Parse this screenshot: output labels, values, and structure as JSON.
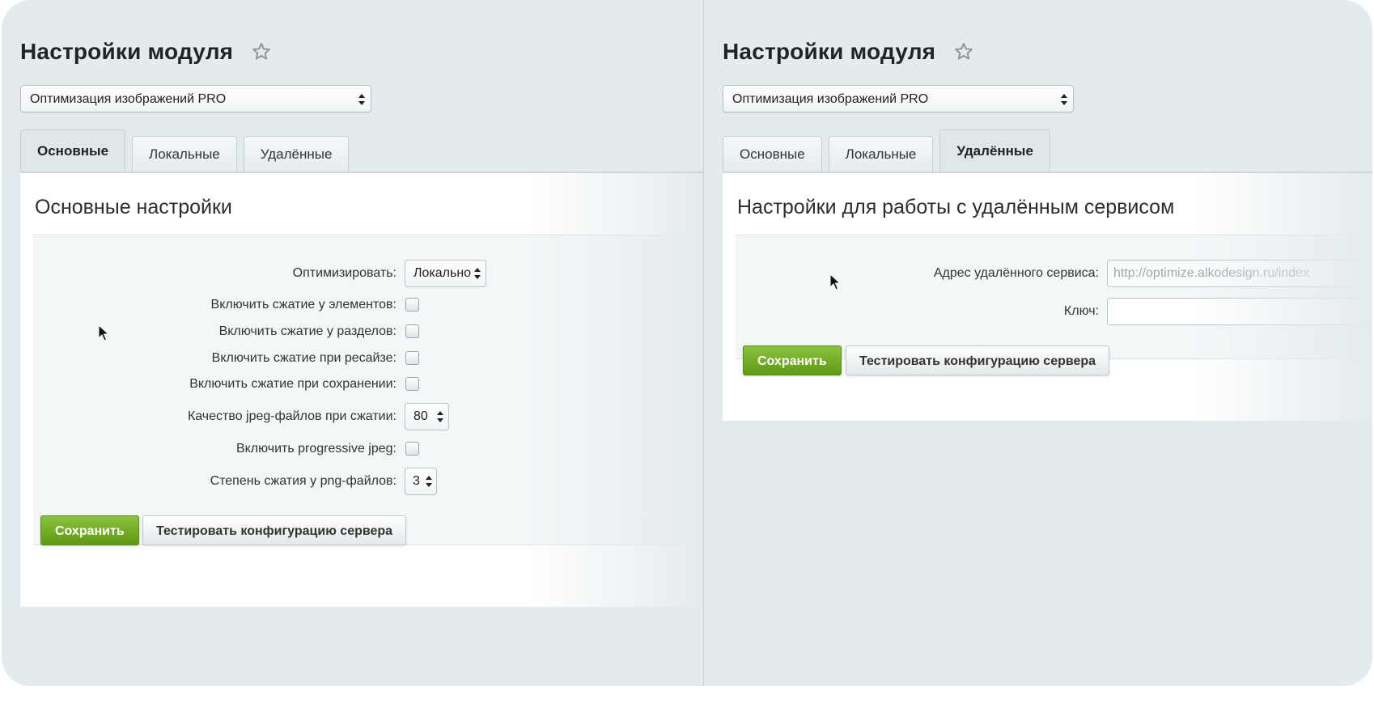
{
  "left": {
    "page_title": "Настройки модуля",
    "module_select_value": "Оптимизация изображений PRO",
    "tabs": [
      {
        "label": "Основные",
        "active": true
      },
      {
        "label": "Локальные",
        "active": false
      },
      {
        "label": "Удалённые",
        "active": false
      }
    ],
    "section_title": "Основные настройки",
    "fields": {
      "optimize_label": "Оптимизировать:",
      "optimize_value": "Локально",
      "elements_label": "Включить сжатие у элементов:",
      "sections_label": "Включить сжатие у разделов:",
      "resize_label": "Включить сжатие при ресайзе:",
      "save_compress_label": "Включить сжатие при сохранении:",
      "jpeg_quality_label": "Качество jpeg-файлов при сжатии:",
      "jpeg_quality_value": "80",
      "progressive_label": "Включить progressive jpeg:",
      "png_level_label": "Степень сжатия у png-файлов:",
      "png_level_value": "3"
    },
    "save_button": "Сохранить",
    "test_button": "Тестировать конфигурацию сервера"
  },
  "right": {
    "page_title": "Настройки модуля",
    "module_select_value": "Оптимизация изображений PRO",
    "tabs": [
      {
        "label": "Основные",
        "active": false
      },
      {
        "label": "Локальные",
        "active": false
      },
      {
        "label": "Удалённые",
        "active": true
      }
    ],
    "section_title": "Настройки для работы с удалённым сервисом",
    "fields": {
      "service_address_label": "Адрес удалённого сервиса:",
      "service_address_placeholder": "http://optimize.alkodesign.ru/index",
      "key_label": "Ключ:",
      "key_value": ""
    },
    "save_button": "Сохранить",
    "test_button": "Тестировать конфигурацию сервера"
  },
  "colors": {
    "background": "#e4ebee",
    "accent_green": "#6fa81f",
    "panel_white": "#ffffff"
  }
}
